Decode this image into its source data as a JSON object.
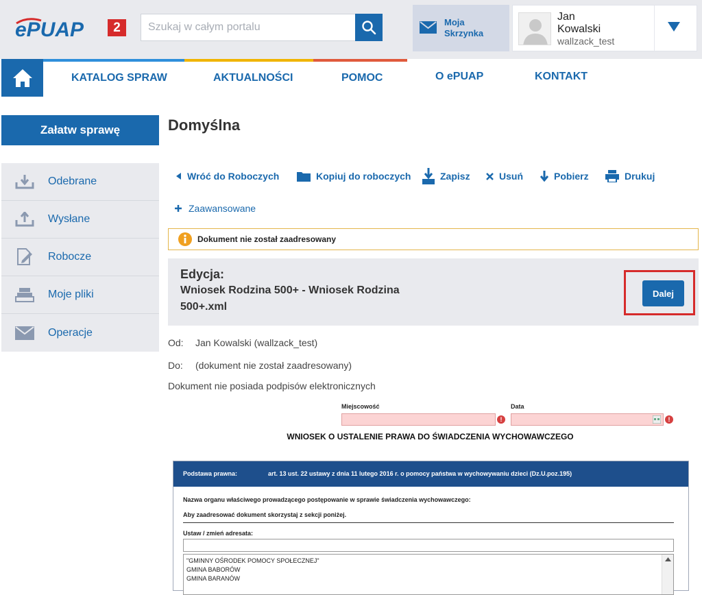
{
  "brand": {
    "name": "ePUAP",
    "version": "2"
  },
  "search": {
    "placeholder": "Szukaj w całym portalu"
  },
  "mailbox": {
    "label_line1": "Moja",
    "label_line2": "Skrzynka"
  },
  "user": {
    "first_name": "Jan",
    "last_name": "Kowalski",
    "login": "wallzack_test"
  },
  "nav": {
    "items": [
      {
        "label": "KATALOG SPRAW",
        "accent": "#2f8fdb"
      },
      {
        "label": "AKTUALNOŚCI",
        "accent": "#f0b400"
      },
      {
        "label": "POMOC",
        "accent": "#e05a3c"
      },
      {
        "label": "O ePUAP",
        "accent": ""
      },
      {
        "label": "KONTAKT",
        "accent": ""
      }
    ]
  },
  "sidebar": {
    "main_button": "Załatw sprawę",
    "items": [
      {
        "label": "Odebrane",
        "icon": "download-tray-icon"
      },
      {
        "label": "Wysłane",
        "icon": "upload-tray-icon"
      },
      {
        "label": "Robocze",
        "icon": "edit-document-icon"
      },
      {
        "label": "Moje pliki",
        "icon": "file-stack-icon"
      },
      {
        "label": "Operacje",
        "icon": "envelope-icon"
      }
    ]
  },
  "page": {
    "title": "Domyślna"
  },
  "toolbar": {
    "back": "Wróć do Roboczych",
    "copy": "Kopiuj do roboczych",
    "save": "Zapisz",
    "delete": "Usuń",
    "download": "Pobierz",
    "print": "Drukuj",
    "advanced": "Zaawansowane"
  },
  "warning": {
    "text": "Dokument nie został zaadresowany"
  },
  "edit": {
    "label": "Edycja:",
    "file_line1": "Wniosek Rodzina 500+ - Wniosek Rodzina",
    "file_line2": "500+.xml",
    "next_button": "Dalej"
  },
  "meta": {
    "from_label": "Od:",
    "from_value": "Jan Kowalski (wallzack_test)",
    "to_label": "Do:",
    "to_value": "(dokument nie został zaadresowany)",
    "signature_note": "Dokument nie posiada podpisów elektronicznych"
  },
  "form": {
    "place_label": "Miejscowość",
    "date_label": "Data",
    "title": "WNIOSEK O USTALENIE PRAWA DO ŚWIADCZENIA WYCHOWAWCZEGO",
    "legal_basis_label": "Podstawa prawna:",
    "legal_basis_value": "art. 13 ust. 22 ustawy z dnia 11 lutego 2016 r. o pomocy państwa w wychowywaniu dzieci (Dz.U.poz.195)",
    "organ_label": "Nazwa organu właściwego prowadzącego postępowanie w sprawie świadczenia wychowawczego:",
    "address_hint": "Aby zaadresować dokument skorzystaj z sekcji poniżej.",
    "set_address_label": "Ustaw / zmień adresata:",
    "address_options": [
      "\"GMINNY OŚRODEK POMOCY SPOŁECZNEJ\"",
      "GMINA BABORÓW",
      "GMINA BARANÓW"
    ]
  },
  "colors": {
    "primary": "#1a69ad",
    "header_bg": "#e9eaee",
    "warning_border": "#e4b54a",
    "highlight": "#d62b2b",
    "form_header": "#1e4f8c"
  }
}
